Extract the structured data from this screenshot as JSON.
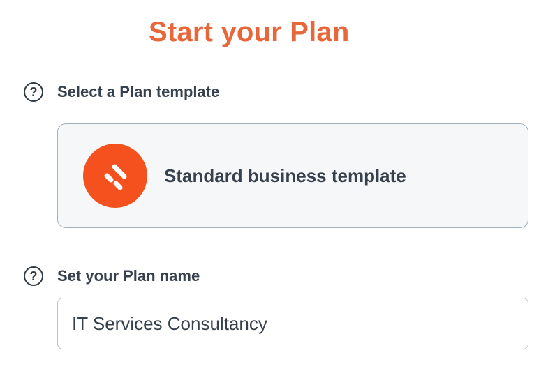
{
  "page": {
    "title": "Start your Plan"
  },
  "template_section": {
    "help_symbol": "?",
    "label": "Select a Plan template",
    "selected_template": {
      "name": "Standard business template",
      "icon": "brand-logo-icon",
      "icon_color": "#f4511e"
    }
  },
  "name_section": {
    "help_symbol": "?",
    "label": "Set your Plan name",
    "input_value": "IT Services Consultancy"
  },
  "colors": {
    "accent": "#e8673a",
    "text": "#36414d",
    "card_background": "#f5f7f9",
    "card_border": "#9fb0bf"
  }
}
